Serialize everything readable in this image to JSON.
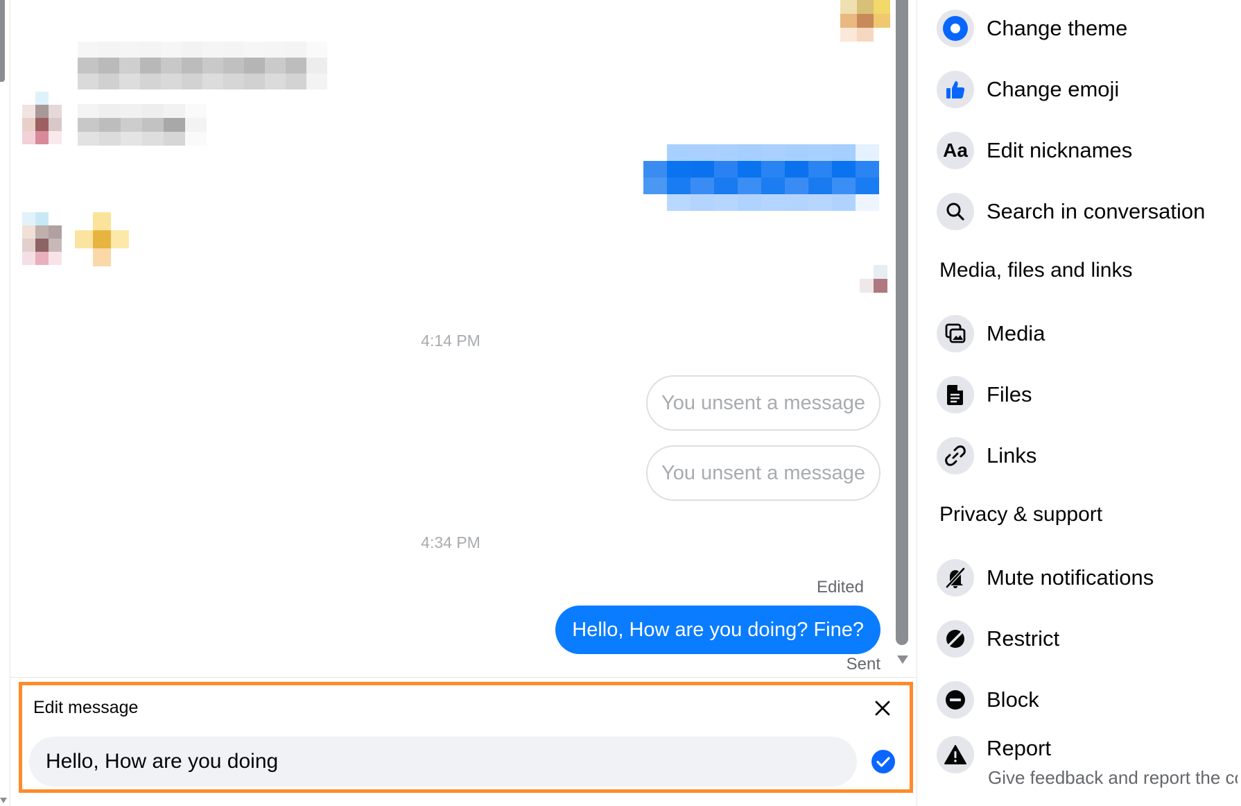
{
  "chat": {
    "timestamps": [
      "4:14 PM",
      "4:34 PM"
    ],
    "unsent_messages": [
      "You unsent a message",
      "You unsent a message"
    ],
    "last_message": {
      "edited_label": "Edited",
      "text": "Hello, How are you doing? Fine?",
      "status": "Sent"
    }
  },
  "edit_panel": {
    "title": "Edit message",
    "input_value": "Hello, How are you doing",
    "accent_color": "#ff8a2a"
  },
  "sidebar": {
    "customize_items": [
      {
        "label": "Change theme",
        "icon": "theme-circle-icon"
      },
      {
        "label": "Change emoji",
        "icon": "thumbs-up-icon"
      },
      {
        "label": "Edit nicknames",
        "icon": "Aa"
      },
      {
        "label": "Search in conversation",
        "icon": "search-icon"
      }
    ],
    "media_heading": "Media, files and links",
    "media_items": [
      {
        "label": "Media",
        "icon": "media-icon"
      },
      {
        "label": "Files",
        "icon": "file-icon"
      },
      {
        "label": "Links",
        "icon": "link-icon"
      }
    ],
    "privacy_heading": "Privacy & support",
    "privacy_items": [
      {
        "label": "Mute notifications",
        "icon": "bell-slash-icon"
      },
      {
        "label": "Restrict",
        "icon": "restrict-icon"
      },
      {
        "label": "Block",
        "icon": "block-icon"
      },
      {
        "label": "Report",
        "icon": "warning-icon"
      }
    ],
    "report_subtitle": "Give feedback and report the conversation"
  },
  "colors": {
    "messenger_blue": "#0a7cff",
    "theme_icon_blue": "#0866ff",
    "muted_text": "#65676b"
  }
}
